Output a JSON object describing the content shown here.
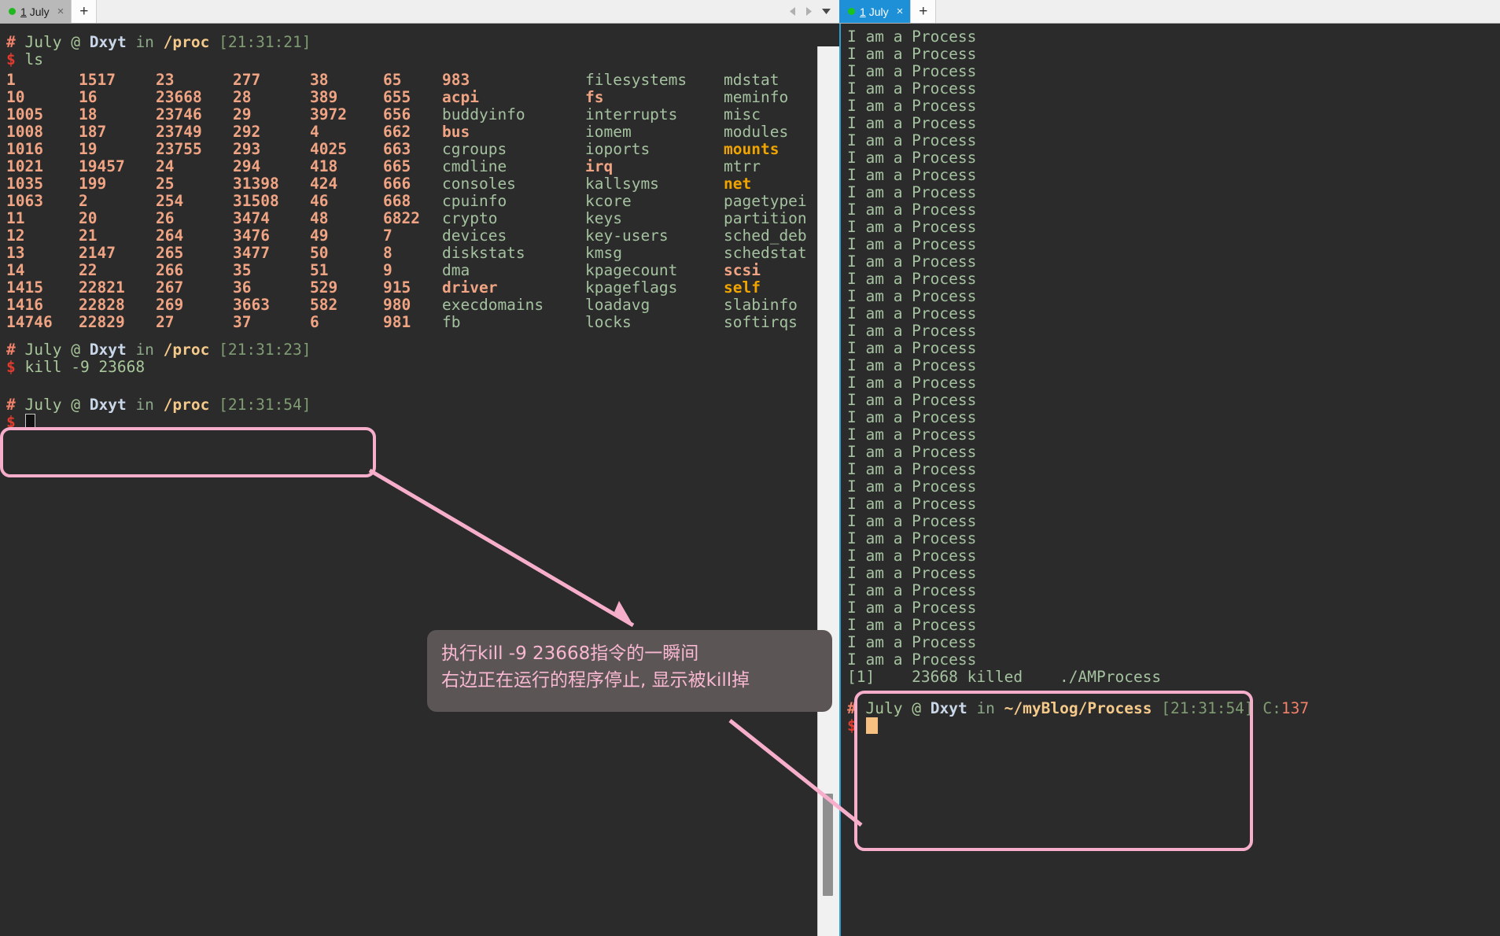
{
  "window": {
    "left_pane": {
      "tab": {
        "label_prefix": "1",
        "label": "July",
        "close_icon": "×",
        "status_dot": "running-dot"
      },
      "new_tab_label": "+",
      "nav_prev_icon": "chevron-left-icon",
      "nav_next_icon": "chevron-right-icon",
      "tab_menu_icon": "chevron-down-icon"
    },
    "right_pane": {
      "tab": {
        "label_prefix": "1",
        "label": "July",
        "close_icon": "×",
        "status_dot": "running-dot"
      },
      "new_tab_label": "+"
    }
  },
  "colors": {
    "terminal_bg": "#2b2b2b",
    "active_tab": "#1e90d8",
    "inactive_tab": "#b9b9b9",
    "annotation_pink": "#f7aecb",
    "tooltip_bg": "#5c5555",
    "tooltip_text": "#f9b8d2",
    "dir_orange": "#f0a483",
    "symlink_amber": "#f0a400",
    "file_green": "#a5c2a0",
    "prompt_hash": "#f0816a",
    "prompt_dollar": "#e03b2f",
    "path_yellow": "#f5c98a",
    "pane_border_blue": "#2f9fd0"
  },
  "left_terminal": {
    "prompt1": {
      "hash": "#",
      "user": "July",
      "at": "@",
      "host": "Dxyt",
      "in": "in",
      "path": "/proc",
      "time": "[21:31:21]"
    },
    "command1": {
      "dollar": "$",
      "text": "ls"
    },
    "ls_columns": [
      [
        "1",
        "10",
        "1005",
        "1008",
        "1016",
        "1021",
        "1035",
        "1063",
        "11",
        "12",
        "13",
        "14",
        "1415",
        "1416",
        "14746"
      ],
      [
        "1517",
        "16",
        "18",
        "187",
        "19",
        "19457",
        "199",
        "2",
        "20",
        "21",
        "2147",
        "22",
        "22821",
        "22828",
        "22829"
      ],
      [
        "23",
        "23668",
        "23746",
        "23749",
        "23755",
        "24",
        "25",
        "254",
        "26",
        "264",
        "265",
        "266",
        "267",
        "269",
        "27"
      ],
      [
        "277",
        "28",
        "29",
        "292",
        "293",
        "294",
        "31398",
        "31508",
        "3474",
        "3476",
        "3477",
        "35",
        "36",
        "3663",
        "37"
      ],
      [
        "38",
        "389",
        "3972",
        "4",
        "4025",
        "418",
        "424",
        "46",
        "48",
        "49",
        "50",
        "51",
        "529",
        "582",
        "6"
      ],
      [
        "65",
        "655",
        "656",
        "662",
        "663",
        "665",
        "666",
        "668",
        "6822",
        "7",
        "8",
        "9",
        "915",
        "980",
        "981"
      ],
      [
        "983",
        "acpi",
        "buddyinfo",
        "bus",
        "cgroups",
        "cmdline",
        "consoles",
        "cpuinfo",
        "crypto",
        "devices",
        "diskstats",
        "dma",
        "driver",
        "execdomains",
        "fb"
      ],
      [
        "filesystems",
        "fs",
        "interrupts",
        "iomem",
        "ioports",
        "irq",
        "kallsyms",
        "kcore",
        "keys",
        "key-users",
        "kmsg",
        "kpagecount",
        "kpageflags",
        "loadavg",
        "locks"
      ],
      [
        "mdstat",
        "meminfo",
        "misc",
        "modules",
        "mounts",
        "mtrr",
        "net",
        "pagetypei",
        "partition",
        "sched_deb",
        "schedstat",
        "scsi",
        "self",
        "slabinfo",
        "softirqs"
      ]
    ],
    "ls_types": [
      [
        "dir",
        "dir",
        "dir",
        "dir",
        "dir",
        "dir",
        "dir",
        "dir",
        "dir",
        "dir",
        "dir",
        "dir",
        "dir",
        "dir",
        "dir"
      ],
      [
        "dir",
        "dir",
        "dir",
        "dir",
        "dir",
        "dir",
        "dir",
        "dir",
        "dir",
        "dir",
        "dir",
        "dir",
        "dir",
        "dir",
        "dir"
      ],
      [
        "dir",
        "dir",
        "dir",
        "dir",
        "dir",
        "dir",
        "dir",
        "dir",
        "dir",
        "dir",
        "dir",
        "dir",
        "dir",
        "dir",
        "dir"
      ],
      [
        "dir",
        "dir",
        "dir",
        "dir",
        "dir",
        "dir",
        "dir",
        "dir",
        "dir",
        "dir",
        "dir",
        "dir",
        "dir",
        "dir",
        "dir"
      ],
      [
        "dir",
        "dir",
        "dir",
        "dir",
        "dir",
        "dir",
        "dir",
        "dir",
        "dir",
        "dir",
        "dir",
        "dir",
        "dir",
        "dir",
        "dir"
      ],
      [
        "dir",
        "dir",
        "dir",
        "dir",
        "dir",
        "dir",
        "dir",
        "dir",
        "dir",
        "dir",
        "dir",
        "dir",
        "dir",
        "dir",
        "dir"
      ],
      [
        "dir",
        "dir",
        "file",
        "dir",
        "file",
        "file",
        "file",
        "file",
        "file",
        "file",
        "file",
        "file",
        "dir",
        "file",
        "file"
      ],
      [
        "file",
        "dir",
        "file",
        "file",
        "file",
        "dir",
        "file",
        "file",
        "file",
        "file",
        "file",
        "file",
        "file",
        "file",
        "file"
      ],
      [
        "file",
        "file",
        "file",
        "file",
        "link",
        "file",
        "link",
        "file",
        "file",
        "file",
        "file",
        "dir",
        "link",
        "file",
        "file"
      ]
    ],
    "prompt2": {
      "hash": "#",
      "user": "July",
      "at": "@",
      "host": "Dxyt",
      "in": "in",
      "path": "/proc",
      "time": "[21:31:23]"
    },
    "command2": {
      "dollar": "$",
      "text": "kill -9 23668"
    },
    "prompt3": {
      "hash": "#",
      "user": "July",
      "at": "@",
      "host": "Dxyt",
      "in": "in",
      "path": "/proc",
      "time": "[21:31:54]"
    },
    "command3": {
      "dollar": "$",
      "text": ""
    }
  },
  "right_terminal": {
    "output_line": "I am a Process",
    "output_count": 37,
    "killed_line": "[1]    23668 killed    ./AMProcess",
    "prompt": {
      "hash": "#",
      "user": "July",
      "at": "@",
      "host": "Dxyt",
      "in": "in",
      "path": "~/myBlog/Process",
      "time": "[21:31:54]",
      "code_label": "C:",
      "code_value": "137"
    },
    "final_dollar": "$"
  },
  "annotations": {
    "tooltip_lines": [
      "执行kill -9 23668指令的一瞬间",
      "右边正在运行的程序停止, 显示被kill掉"
    ],
    "highlight_left_name": "kill-command-highlight",
    "highlight_right_name": "killed-output-highlight"
  }
}
